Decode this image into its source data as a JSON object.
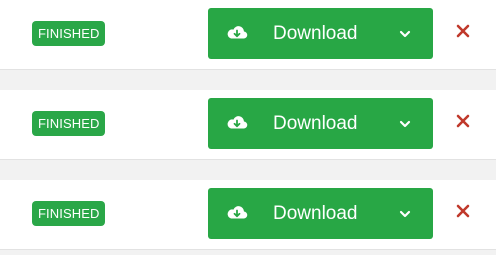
{
  "colors": {
    "accent_green": "#28a745",
    "badge_green": "#2aa748",
    "remove_red": "#c0392b",
    "row_bg": "#ffffff",
    "page_bg": "#f2f2f2"
  },
  "downloads": [
    {
      "status": "FINISHED",
      "download_label": "Download",
      "icons": {
        "download": "cloud-download-icon",
        "menu": "chevron-down-icon",
        "remove": "close-icon"
      }
    },
    {
      "status": "FINISHED",
      "download_label": "Download",
      "icons": {
        "download": "cloud-download-icon",
        "menu": "chevron-down-icon",
        "remove": "close-icon"
      }
    },
    {
      "status": "FINISHED",
      "download_label": "Download",
      "icons": {
        "download": "cloud-download-icon",
        "menu": "chevron-down-icon",
        "remove": "close-icon"
      }
    }
  ]
}
